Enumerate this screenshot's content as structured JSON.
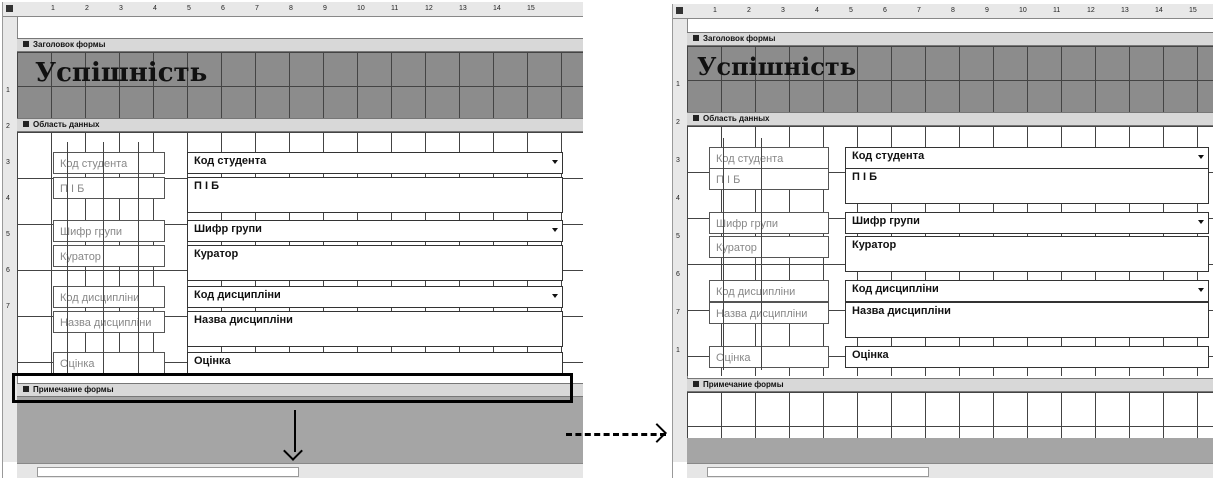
{
  "left": {
    "ruler_numbers": [
      "1",
      "2",
      "3",
      "4",
      "5",
      "6",
      "7",
      "8",
      "9",
      "10",
      "11",
      "12",
      "13",
      "14",
      "15"
    ],
    "ruler_left_numbers": [
      "1",
      "2",
      "3",
      "4",
      "5",
      "6",
      "7"
    ],
    "header_band": "Заголовок формы",
    "title": "Успішність",
    "data_band": "Область данных",
    "rows": [
      {
        "label": "Код студента",
        "value": "Код студента"
      },
      {
        "label": "П І Б",
        "value": "П І Б"
      },
      {
        "label": "Шифр групи",
        "value": "Шифр групи"
      },
      {
        "label": "Куратор",
        "value": "Куратор"
      },
      {
        "label": "Код дисципліни",
        "value": "Код дисципліни"
      },
      {
        "label": "Назва дисципліни",
        "value": "Назва дисципліни"
      },
      {
        "label": "Оцінка",
        "value": "Оцінка"
      }
    ],
    "footer_band": "Примечание формы"
  },
  "right": {
    "ruler_numbers": [
      "1",
      "2",
      "3",
      "4",
      "5",
      "6",
      "7",
      "8",
      "9",
      "10",
      "11",
      "12",
      "13",
      "14",
      "15"
    ],
    "ruler_left_numbers": [
      "1",
      "2",
      "3",
      "4",
      "5",
      "6",
      "7",
      "1"
    ],
    "header_band": "Заголовок формы",
    "title": "Успішність",
    "data_band": "Область данных",
    "rows": [
      {
        "label": "Код студента",
        "value": "Код студента"
      },
      {
        "label": "П І Б",
        "value": "П І Б"
      },
      {
        "label": "Шифр групи",
        "value": "Шифр групи"
      },
      {
        "label": "Куратор",
        "value": "Куратор"
      },
      {
        "label": "Код дисципліни",
        "value": "Код дисципліни"
      },
      {
        "label": "Назва дисципліни",
        "value": "Назва дисципліни"
      },
      {
        "label": "Оцінка",
        "value": "Оцінка"
      }
    ],
    "footer_band": "Примечание формы"
  },
  "colors": {
    "band": "#d8d8d8",
    "header_area": "#8c8c8c",
    "empty_area": "#a5a5a5",
    "highlight": "#000000"
  },
  "icons": [
    "band-selector-icon",
    "dropdown-arrow-icon",
    "arrow-down-icon",
    "arrow-right-icon"
  ]
}
